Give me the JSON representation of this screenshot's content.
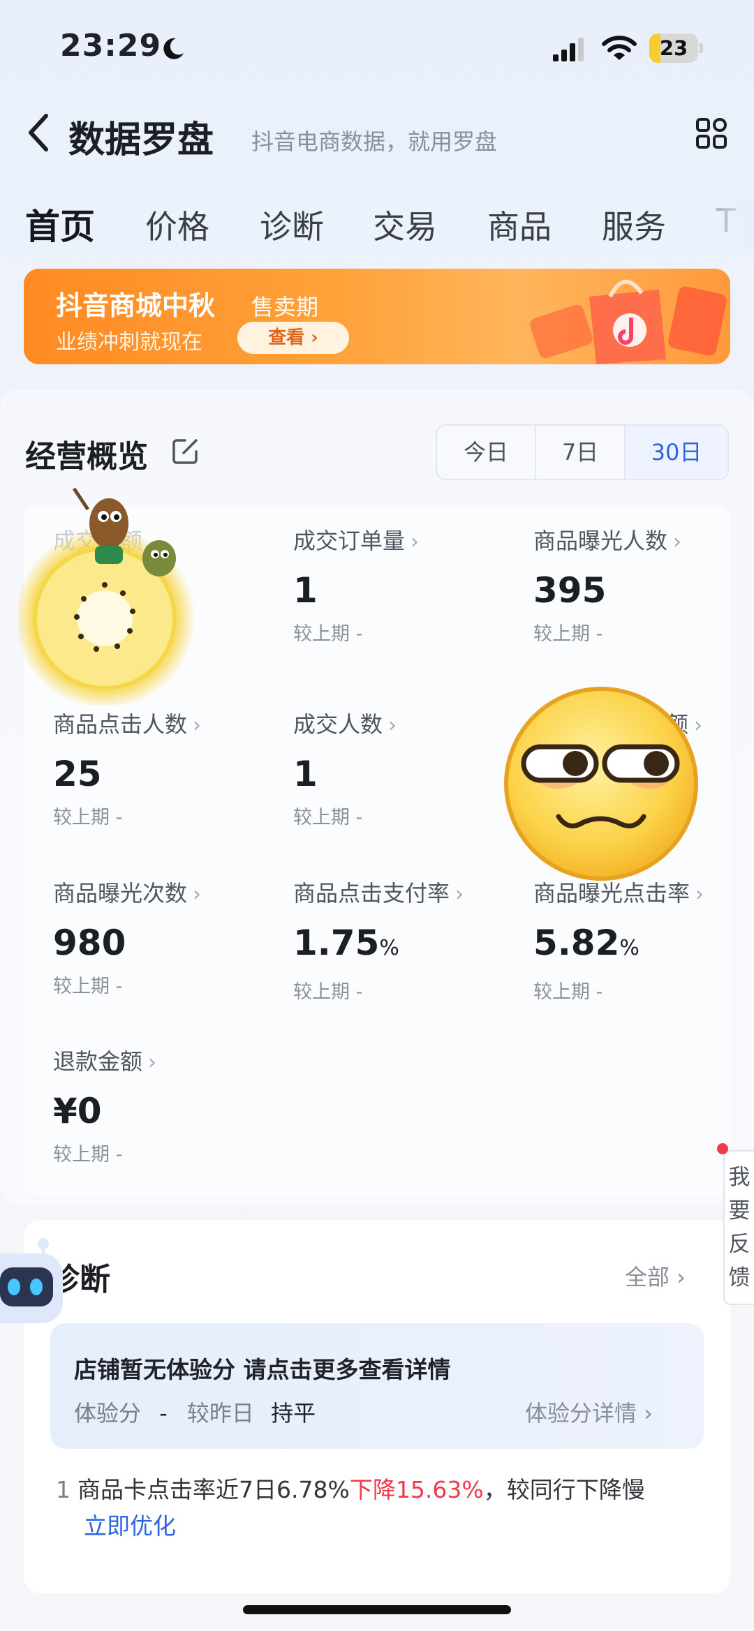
{
  "status_bar": {
    "time": "23:29",
    "battery": "23",
    "battery_level": 0.23
  },
  "header": {
    "title": "数据罗盘",
    "subtitle": "抖音电商数据，就用罗盘"
  },
  "tabs": [
    {
      "label": "首页",
      "active": true
    },
    {
      "label": "价格",
      "active": false
    },
    {
      "label": "诊断",
      "active": false
    },
    {
      "label": "交易",
      "active": false
    },
    {
      "label": "商品",
      "active": false
    },
    {
      "label": "服务",
      "active": false
    },
    {
      "label": "T",
      "active": false
    }
  ],
  "banner": {
    "title": "抖音商城中秋",
    "tag": "售卖期",
    "subtitle": "业绩冲刺就现在",
    "button": "查看 ›"
  },
  "overview": {
    "title": "经营概览",
    "ranges": [
      "今日",
      "7日",
      "30日"
    ],
    "selected_range": "30日",
    "metrics": [
      {
        "label": "成交金额",
        "value": "",
        "unit": "",
        "compare": ""
      },
      {
        "label": "成交订单量",
        "value": "1",
        "unit": "",
        "compare": "较上期 -"
      },
      {
        "label": "商品曝光人数",
        "value": "395",
        "unit": "",
        "compare": "较上期 -"
      },
      {
        "label": "商品点击人数",
        "value": "25",
        "unit": "",
        "compare": "较上期 -"
      },
      {
        "label": "成交人数",
        "value": "1",
        "unit": "",
        "compare": "较上期 -"
      },
      {
        "label": "额",
        "value": "",
        "unit": "",
        "compare": ""
      },
      {
        "label": "商品曝光次数",
        "value": "980",
        "unit": "",
        "compare": "较上期 -"
      },
      {
        "label": "商品点击支付率",
        "value": "1.75",
        "unit": "%",
        "compare": "较上期 -"
      },
      {
        "label": "商品曝光点击率",
        "value": "5.82",
        "unit": "%",
        "compare": "较上期 -"
      },
      {
        "label": "退款金额",
        "value": "¥0",
        "unit": "",
        "compare": "较上期 -"
      }
    ]
  },
  "diagnosis": {
    "title": "诊断",
    "all_link": "全部 ›",
    "box_title": "店铺暂无体验分 请点击更多查看详情",
    "score_label": "体验分",
    "score_value": "-",
    "vs_label": "较昨日",
    "vs_value": "持平",
    "detail_link": "体验分详情 ›",
    "item_index": "1",
    "item_text": "商品卡点击率近7日6.78%",
    "item_drop": "下降15.63%",
    "item_tail": "，较同行下降慢",
    "item_action": "立即优化"
  },
  "feedback": {
    "chars": [
      "我",
      "要",
      "反",
      "馈"
    ]
  },
  "colors": {
    "accent": "#2b64e4",
    "alert": "#f0394a",
    "banner": "#ff9a3b"
  },
  "icons": {
    "back": "chevron-left-icon",
    "menu": "grid-icon",
    "edit": "edit-icon",
    "moon": "moon-icon",
    "signal": "signal-icon",
    "wifi": "wifi-icon"
  }
}
